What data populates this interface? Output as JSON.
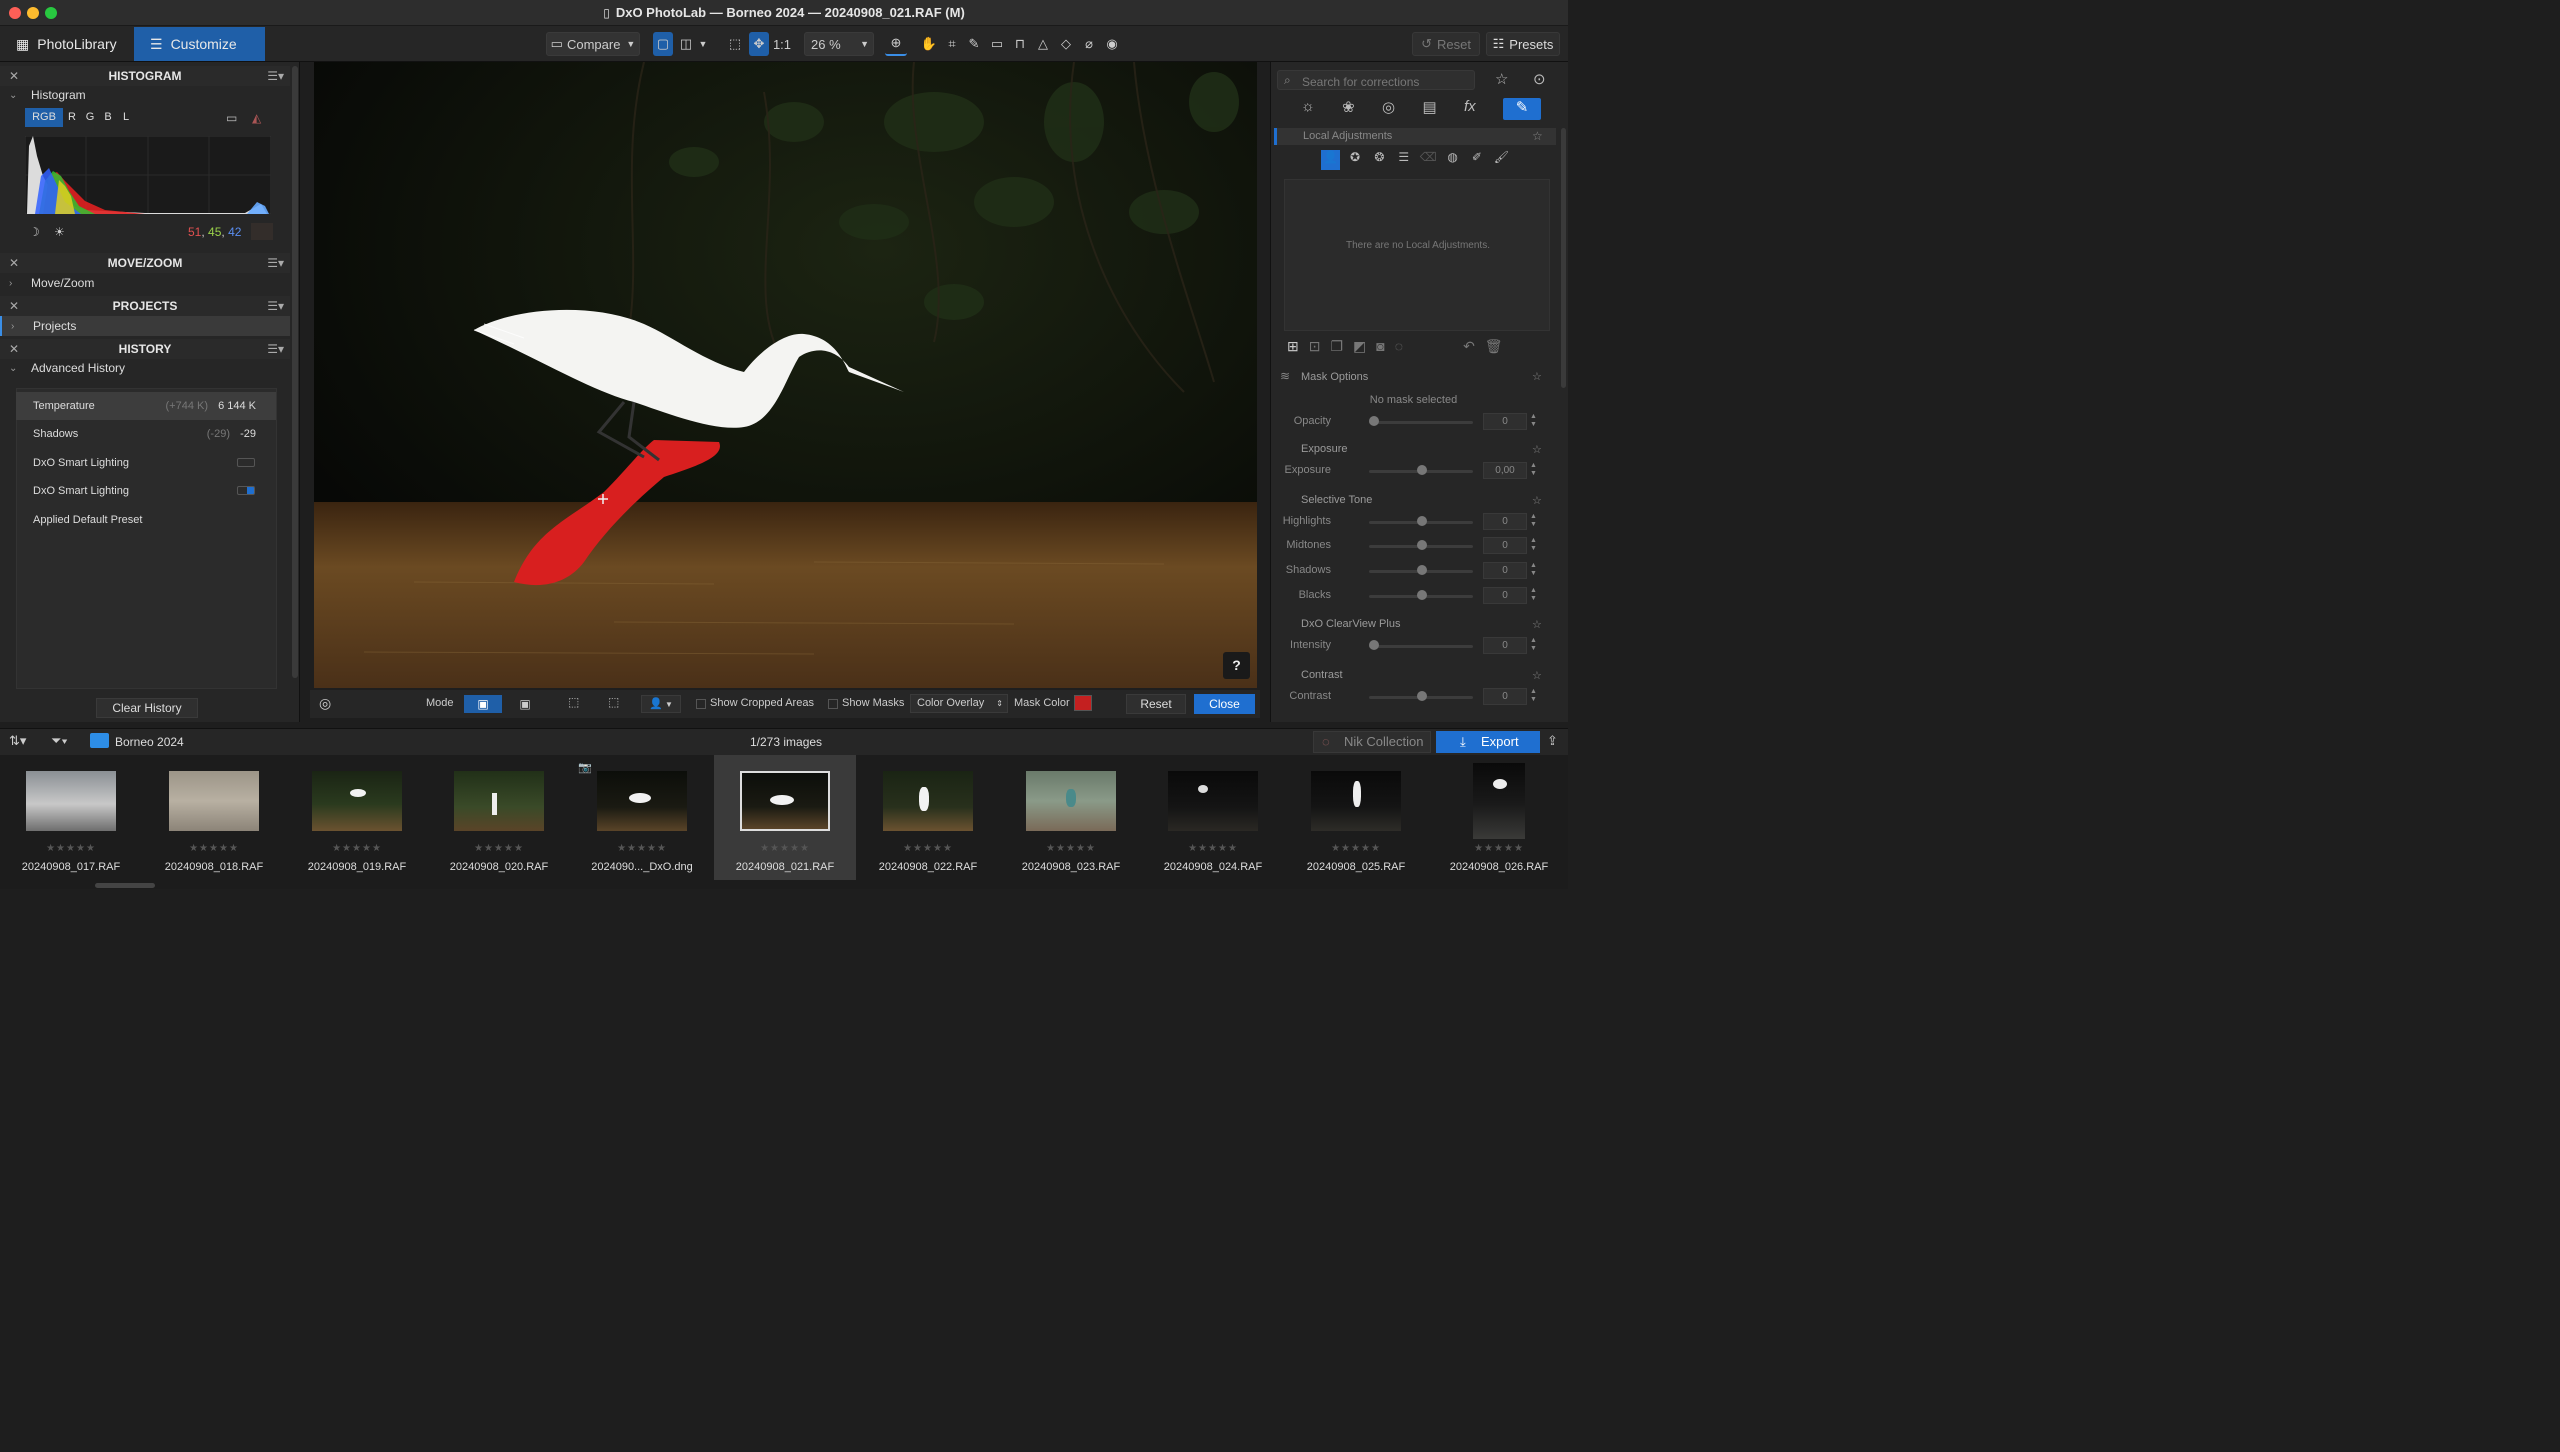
{
  "window": {
    "title": "DxO PhotoLab — Borneo 2024 — 20240908_021.RAF (M)"
  },
  "tabs": {
    "library": "PhotoLibrary",
    "customize": "Customize"
  },
  "toolbar": {
    "compare": "Compare",
    "one_to_one": "1:1",
    "zoom": "26 %",
    "reset": "Reset",
    "presets": "Presets"
  },
  "left_panel": {
    "histogram": {
      "title": "HISTOGRAM",
      "sub": "Histogram",
      "channels": [
        "RGB",
        "R",
        "G",
        "B",
        "L"
      ],
      "r": "51",
      "g": "45",
      "b": "42"
    },
    "movezoom": {
      "title": "MOVE/ZOOM",
      "sub": "Move/Zoom"
    },
    "projects": {
      "title": "PROJECTS",
      "sub": "Projects"
    },
    "history": {
      "title": "HISTORY",
      "sub": "Advanced History",
      "clear": "Clear History",
      "rows": [
        {
          "label": "Temperature",
          "delta": "(+744 K)",
          "value": "6 144 K"
        },
        {
          "label": "Shadows",
          "delta": "(-29)",
          "value": "-29"
        },
        {
          "label": "DxO Smart Lighting",
          "delta": "",
          "value": ""
        },
        {
          "label": "DxO Smart Lighting",
          "delta": "",
          "value": ""
        },
        {
          "label": "Applied Default Preset",
          "delta": "",
          "value": ""
        }
      ]
    }
  },
  "bottombar": {
    "mode": "Mode",
    "show_cropped": "Show Cropped Areas",
    "show_masks": "Show Masks",
    "color_overlay": "Color Overlay",
    "mask_color": "Mask Color",
    "reset": "Reset",
    "close": "Close",
    "help": "?"
  },
  "right_panel": {
    "search_placeholder": "Search for corrections",
    "local_adj": "Local Adjustments",
    "no_local": "There are no Local Adjustments.",
    "mask_options": "Mask Options",
    "no_mask": "No mask selected",
    "opacity": {
      "label": "Opacity",
      "value": "0"
    },
    "exposure_title": "Exposure",
    "exposure": {
      "label": "Exposure",
      "value": "0,00"
    },
    "tone_title": "Selective Tone",
    "highlights": {
      "label": "Highlights",
      "value": "0"
    },
    "midtones": {
      "label": "Midtones",
      "value": "0"
    },
    "shadows": {
      "label": "Shadows",
      "value": "0"
    },
    "blacks": {
      "label": "Blacks",
      "value": "0"
    },
    "clearview_title": "DxO ClearView Plus",
    "intensity": {
      "label": "Intensity",
      "value": "0"
    },
    "contrast_title": "Contrast",
    "contrast": {
      "label": "Contrast",
      "value": "0"
    }
  },
  "filmbar": {
    "folder": "Borneo 2024",
    "count": "1/273 images",
    "nik": "Nik Collection",
    "export": "Export"
  },
  "filmstrip": [
    "20240908_017.RAF",
    "20240908_018.RAF",
    "20240908_019.RAF",
    "20240908_020.RAF",
    "2024090..._DxO.dng",
    "20240908_021.RAF",
    "20240908_022.RAF",
    "20240908_023.RAF",
    "20240908_024.RAF",
    "20240908_025.RAF",
    "20240908_026.RAF"
  ],
  "stars": "★★★★★"
}
